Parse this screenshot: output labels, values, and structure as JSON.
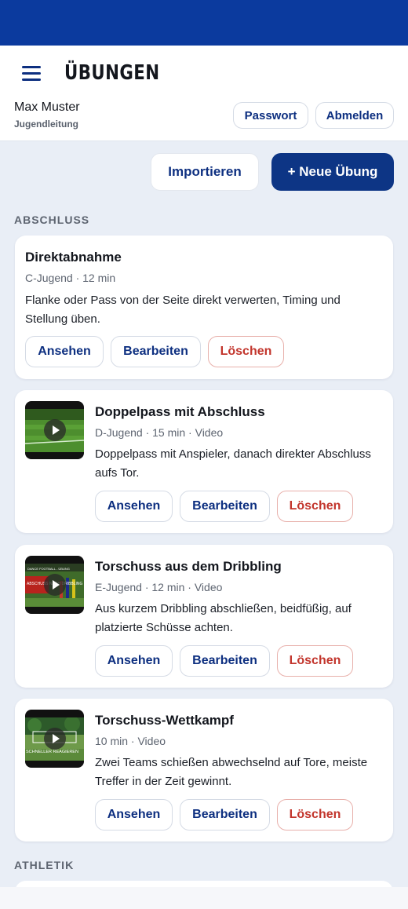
{
  "header": {
    "title": "ÜBUNGEN",
    "user_name": "Max Muster",
    "user_role": "Jugendleitung",
    "password_label": "Passwort",
    "logout_label": "Abmelden"
  },
  "toolbar": {
    "import_label": "Importieren",
    "new_label": "+ Neue Übung"
  },
  "sections": [
    {
      "label": "ABSCHLUSS"
    },
    {
      "label": "ATHLETIK"
    }
  ],
  "actions": {
    "view": "Ansehen",
    "edit": "Bearbeiten",
    "delete": "Löschen"
  },
  "exercises": [
    {
      "title": "Direktabnahme",
      "meta": "C-Jugend · 12 min",
      "description_line1": "Flanke oder Pass von der Seite direkt verwerten, Timing und",
      "description_line2": "Stellung üben.",
      "has_video": false
    },
    {
      "title": "Doppelpass mit Abschluss",
      "meta": "D-Jugend · 15 min · Video",
      "description_line1": "Doppelpass mit Anspieler, danach direkter Abschluss",
      "description_line2": "aufs Tor.",
      "has_video": true
    },
    {
      "title": "Torschuss aus dem Dribbling",
      "meta": "E-Jugend · 12 min · Video",
      "description_line1": "Aus kurzem Dribbling abschließen, beidfüßig, auf",
      "description_line2": "platzierte Schüsse achten.",
      "has_video": true,
      "thumb_caption_top": "DANCE FOOTBALL - ÜBUNG",
      "thumb_caption": "ABSCHUSS NACH DRIBBLING"
    },
    {
      "title": "Torschuss-Wettkampf",
      "meta": "10 min · Video",
      "description_line1": "Zwei Teams schießen abwechselnd auf Tore, meiste",
      "description_line2": "Treffer in der Zeit gewinnt.",
      "has_video": true,
      "thumb_caption": "SCHNELLER REAGIEREN"
    }
  ],
  "colors": {
    "brand": "#0b3a9e",
    "primary_button": "#0d3585",
    "delete": "#c2352c",
    "background": "#e9eef6"
  }
}
